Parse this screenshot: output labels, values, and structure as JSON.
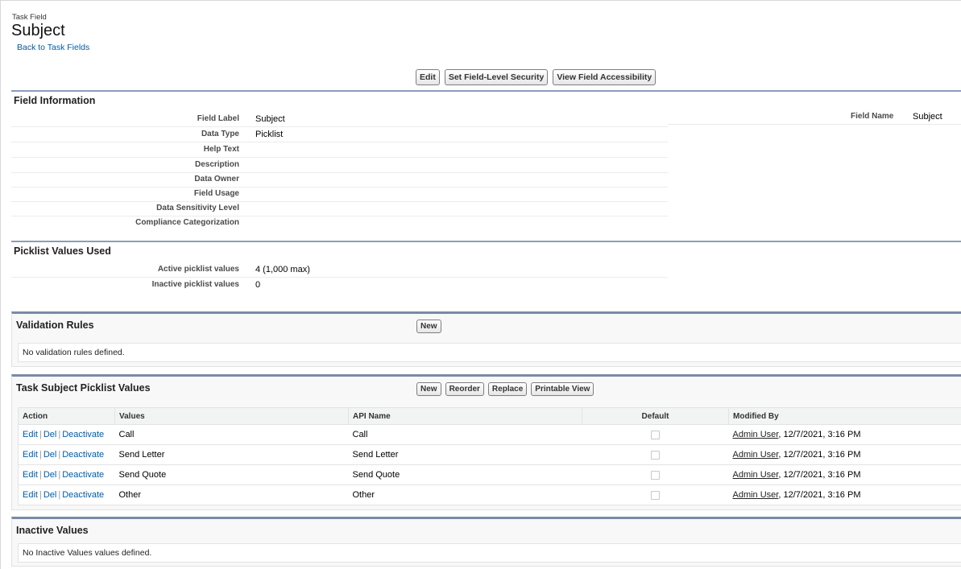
{
  "header": {
    "object_type": "Task Field",
    "title": "Subject",
    "back_link": "Back to Task Fields"
  },
  "toolbar": {
    "edit": "Edit",
    "set_fls": "Set Field-Level Security",
    "view_access": "View Field Accessibility"
  },
  "field_info": {
    "title": "Field Information",
    "rows": [
      {
        "label": "Field Label",
        "value": "Subject"
      },
      {
        "label": "Data Type",
        "value": "Picklist"
      },
      {
        "label": "Help Text",
        "value": ""
      },
      {
        "label": "Description",
        "value": ""
      },
      {
        "label": "Data Owner",
        "value": ""
      },
      {
        "label": "Field Usage",
        "value": ""
      },
      {
        "label": "Data Sensitivity Level",
        "value": ""
      },
      {
        "label": "Compliance Categorization",
        "value": ""
      }
    ],
    "field_name_label": "Field Name",
    "field_name_value": "Subject"
  },
  "picklist_used": {
    "title": "Picklist Values Used",
    "rows": [
      {
        "label": "Active picklist values",
        "value": "4 (1,000 max)"
      },
      {
        "label": "Inactive picklist values",
        "value": "0"
      }
    ]
  },
  "validation_rules": {
    "title": "Validation Rules",
    "new_label": "New",
    "empty_text": "No validation rules defined."
  },
  "picklist_values": {
    "title": "Task Subject Picklist Values",
    "buttons": {
      "new": "New",
      "reorder": "Reorder",
      "replace": "Replace",
      "printable": "Printable View"
    },
    "columns": {
      "action": "Action",
      "values": "Values",
      "api_name": "API Name",
      "default": "Default",
      "modified_by": "Modified By"
    },
    "action_links": {
      "edit": "Edit",
      "del": "Del",
      "deactivate": "Deactivate",
      "sep": "|"
    },
    "rows": [
      {
        "value": "Call",
        "api_name": "Call",
        "user": "Admin User",
        "date": ", 12/7/2021, 3:16 PM"
      },
      {
        "value": "Send Letter",
        "api_name": "Send Letter",
        "user": "Admin User",
        "date": ", 12/7/2021, 3:16 PM"
      },
      {
        "value": "Send Quote",
        "api_name": "Send Quote",
        "user": "Admin User",
        "date": ", 12/7/2021, 3:16 PM"
      },
      {
        "value": "Other",
        "api_name": "Other",
        "user": "Admin User",
        "date": ", 12/7/2021, 3:16 PM"
      }
    ]
  },
  "inactive_values": {
    "title": "Inactive Values",
    "empty_text": "No Inactive Values values defined."
  },
  "colors": {
    "link": "#015ba7",
    "section_rule": "#8a9ebe"
  }
}
